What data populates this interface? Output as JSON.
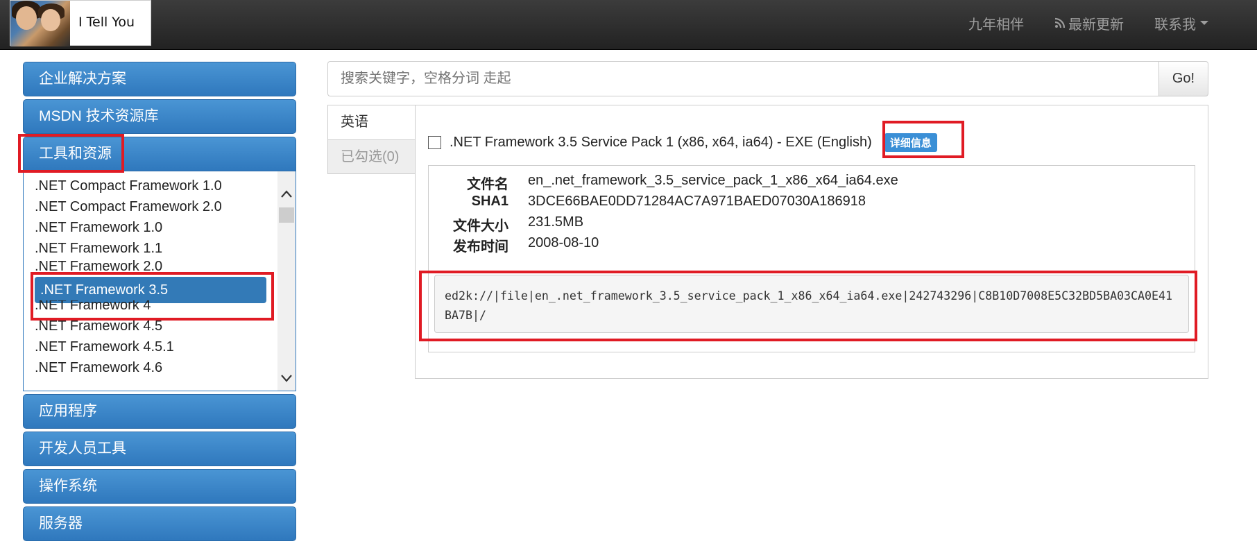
{
  "navbar": {
    "logo_text": "I Tell You",
    "links": [
      {
        "label": "九年相伴"
      },
      {
        "label": "最新更新",
        "icon": "rss-icon"
      },
      {
        "label": "联系我",
        "icon": "caret-down-icon"
      }
    ]
  },
  "sidebar": {
    "categories_top": [
      {
        "label": "企业解决方案"
      },
      {
        "label": "MSDN 技术资源库"
      },
      {
        "label": "工具和资源"
      }
    ],
    "submenu": [
      ".NET Compact Framework 1.0",
      ".NET Compact Framework 2.0",
      ".NET Framework 1.0",
      ".NET Framework 1.1",
      ".NET Framework 2.0",
      ".NET Framework 3.5",
      ".NET Framework 4",
      ".NET Framework 4.5",
      ".NET Framework 4.5.1",
      ".NET Framework 4.6"
    ],
    "active_item": ".NET Framework 3.5",
    "categories_bottom": [
      {
        "label": "应用程序"
      },
      {
        "label": "开发人员工具"
      },
      {
        "label": "操作系统"
      },
      {
        "label": "服务器"
      }
    ]
  },
  "search": {
    "placeholder": "搜索关键字，空格分词 走起",
    "button": "Go!"
  },
  "tabs": {
    "language": "英语",
    "selected": "已勾选(0)"
  },
  "item": {
    "title": ".NET Framework 3.5 Service Pack 1 (x86, x64, ia64) - EXE (English)",
    "badge": "详细信息",
    "fields": {
      "filename_label": "文件名",
      "filename": "en_.net_framework_3.5_service_pack_1_x86_x64_ia64.exe",
      "sha1_label": "SHA1",
      "sha1": "3DCE66BAE0DD71284AC7A971BAED07030A186918",
      "size_label": "文件大小",
      "size": "231.5MB",
      "date_label": "发布时间",
      "date": "2008-08-10"
    },
    "ed2k": "ed2k://|file|en_.net_framework_3.5_service_pack_1_x86_x64_ia64.exe|242743296|C8B10D7008E5C32BD5BA03CA0E41BA7B|/"
  },
  "colors": {
    "accent": "#337ab7",
    "annotation": "#e01b24"
  }
}
